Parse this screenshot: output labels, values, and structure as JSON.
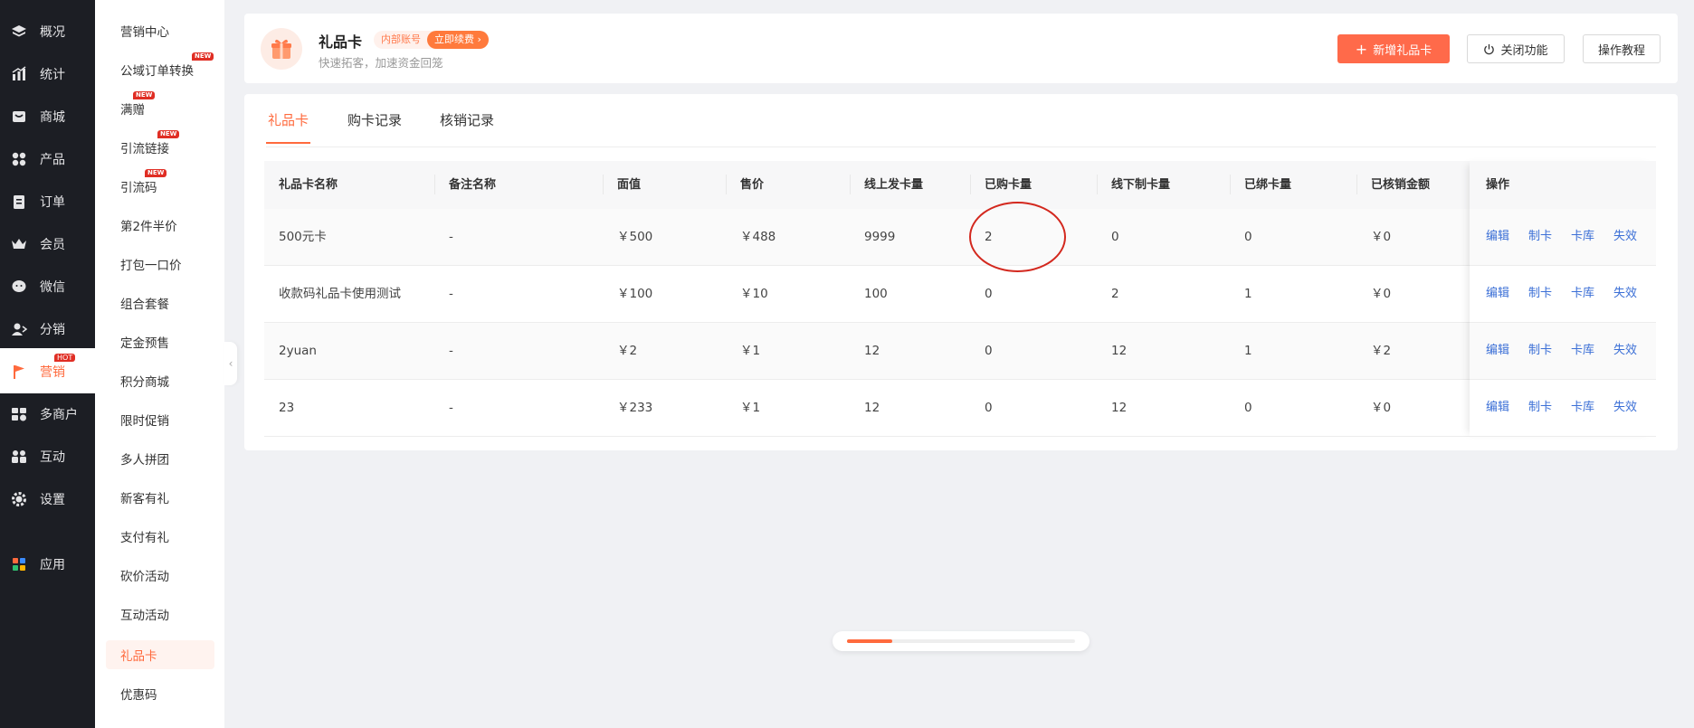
{
  "nav": {
    "items": [
      {
        "label": "概况",
        "icon": "layers-icon",
        "name": "nav-overview"
      },
      {
        "label": "统计",
        "icon": "chart-icon",
        "name": "nav-stats"
      },
      {
        "label": "商城",
        "icon": "store-icon",
        "name": "nav-mall"
      },
      {
        "label": "产品",
        "icon": "grid-icon",
        "name": "nav-products"
      },
      {
        "label": "订单",
        "icon": "order-icon",
        "name": "nav-orders"
      },
      {
        "label": "会员",
        "icon": "crown-icon",
        "name": "nav-members"
      },
      {
        "label": "微信",
        "icon": "wechat-icon",
        "name": "nav-wechat"
      },
      {
        "label": "分销",
        "icon": "user-share-icon",
        "name": "nav-distribution"
      },
      {
        "label": "营销",
        "icon": "flag-icon",
        "name": "nav-marketing",
        "badge": "HOT",
        "active": true
      },
      {
        "label": "多商户",
        "icon": "merchant-icon",
        "name": "nav-multi-merchant"
      },
      {
        "label": "互动",
        "icon": "interact-icon",
        "name": "nav-interaction"
      },
      {
        "label": "设置",
        "icon": "gear-icon",
        "name": "nav-settings"
      },
      {
        "label": "应用",
        "icon": "apps-icon",
        "name": "nav-apps"
      }
    ],
    "active_color": "#ff6a3d"
  },
  "submenu": {
    "items": [
      {
        "label": "营销中心"
      },
      {
        "label": "公域订单转换",
        "badge": "NEW"
      },
      {
        "label": "满赠",
        "badge": "NEW"
      },
      {
        "label": "引流链接",
        "badge": "NEW"
      },
      {
        "label": "引流码",
        "badge": "NEW"
      },
      {
        "label": "第2件半价"
      },
      {
        "label": "打包一口价"
      },
      {
        "label": "组合套餐"
      },
      {
        "label": "定金预售"
      },
      {
        "label": "积分商城"
      },
      {
        "label": "限时促销"
      },
      {
        "label": "多人拼团"
      },
      {
        "label": "新客有礼"
      },
      {
        "label": "支付有礼"
      },
      {
        "label": "砍价活动"
      },
      {
        "label": "互动活动"
      },
      {
        "label": "礼品卡",
        "active": true
      },
      {
        "label": "优惠码"
      }
    ]
  },
  "header": {
    "title": "礼品卡",
    "inner_tag": "内部账号",
    "renew_tag": "立即续费",
    "subtitle": "快速拓客，加速资金回笼",
    "add_button": "新增礼品卡",
    "close_button": "关闭功能",
    "tutorial_button": "操作教程",
    "accent": "#ff6a4a"
  },
  "tabs": [
    {
      "label": "礼品卡",
      "active": true
    },
    {
      "label": "购卡记录"
    },
    {
      "label": "核销记录"
    }
  ],
  "table": {
    "columns": [
      "礼品卡名称",
      "备注名称",
      "面值",
      "售价",
      "线上发卡量",
      "已购卡量",
      "线下制卡量",
      "已绑卡量",
      "已核销金额",
      "操作"
    ],
    "rows": [
      [
        "500元卡",
        "-",
        "￥500",
        "￥488",
        "9999",
        "2",
        "0",
        "0",
        "￥0"
      ],
      [
        "收款码礼品卡使用测试",
        "-",
        "￥100",
        "￥10",
        "100",
        "0",
        "2",
        "1",
        "￥0"
      ],
      [
        "2yuan",
        "-",
        "￥2",
        "￥1",
        "12",
        "0",
        "12",
        "1",
        "￥2"
      ],
      [
        "23",
        "-",
        "￥233",
        "￥1",
        "12",
        "0",
        "12",
        "0",
        "￥0"
      ]
    ],
    "actions": [
      "编辑",
      "制卡",
      "卡库",
      "失效"
    ],
    "link_color": "#3b6fd6"
  }
}
